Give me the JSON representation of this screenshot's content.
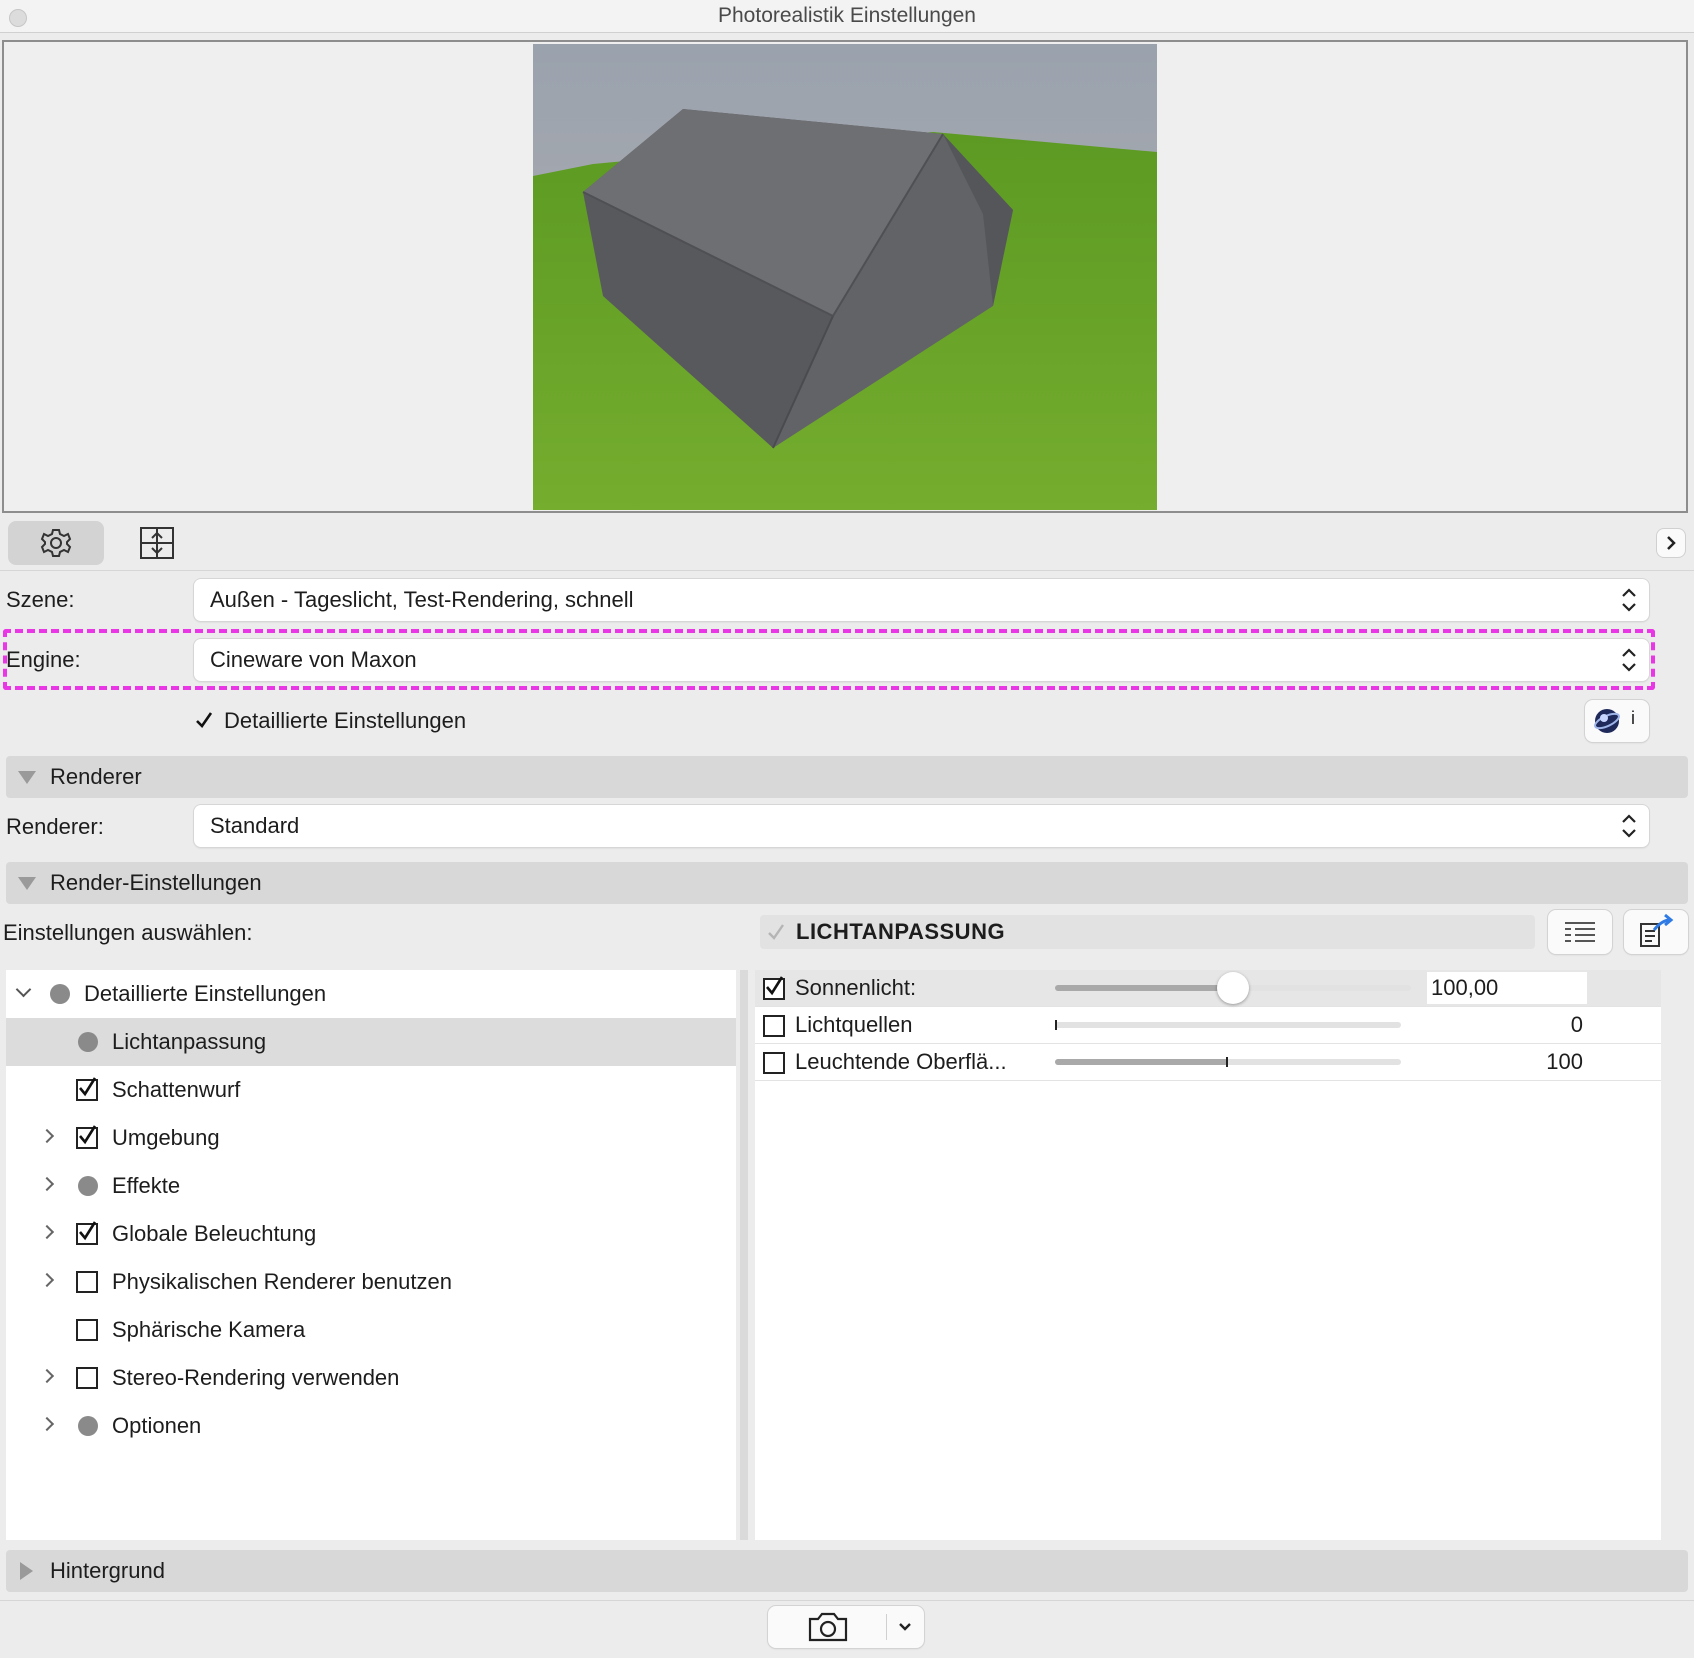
{
  "window": {
    "title": "Photorealistik Einstellungen"
  },
  "preview": {
    "icon": "rendered-house-preview"
  },
  "toolbar": {
    "settings_icon": "gear-icon",
    "frame_icon": "frame-crop-icon",
    "expand_icon": "chevron-right-icon"
  },
  "scene": {
    "label": "Szene:",
    "value": "Außen - Tageslicht, Test-Rendering, schnell"
  },
  "engine": {
    "label": "Engine:",
    "value": "Cineware von Maxon"
  },
  "detailed": {
    "label": "Detaillierte Einstellungen",
    "checked": true,
    "info_icon_text": "i"
  },
  "renderer_section": {
    "title": "Renderer",
    "label": "Renderer:",
    "value": "Standard"
  },
  "render_settings_section": {
    "title": "Render-Einstellungen",
    "select_label": "Einstellungen auswählen:"
  },
  "panel_header": {
    "title": "LICHTANPASSUNG",
    "list_icon": "list-view-icon",
    "export_icon": "export-icon"
  },
  "tree": [
    {
      "label": "Detaillierte Einstellungen",
      "marker": "dot",
      "expanded": true
    },
    {
      "label": "Lichtanpassung",
      "marker": "dot",
      "selected": true
    },
    {
      "label": "Schattenwurf",
      "marker": "checked"
    },
    {
      "label": "Umgebung",
      "marker": "checked",
      "expandable": true
    },
    {
      "label": "Effekte",
      "marker": "dot",
      "expandable": true
    },
    {
      "label": "Globale Beleuchtung",
      "marker": "checked",
      "expandable": true
    },
    {
      "label": "Physikalischen Renderer benutzen",
      "marker": "unchecked",
      "expandable": true
    },
    {
      "label": "Sphärische Kamera",
      "marker": "unchecked"
    },
    {
      "label": "Stereo-Rendering verwenden",
      "marker": "unchecked",
      "expandable": true
    },
    {
      "label": "Optionen",
      "marker": "dot",
      "expandable": true
    }
  ],
  "params": [
    {
      "label": "Sonnenlicht:",
      "checked": true,
      "level": 0.5,
      "value": "100,00"
    },
    {
      "label": "Lichtquellen",
      "checked": false,
      "level": 0.0,
      "value": "0"
    },
    {
      "label": "Leuchtende Oberflä...",
      "checked": false,
      "level": 0.5,
      "value": "100"
    }
  ],
  "background_section": {
    "title": "Hintergrund"
  },
  "bottom": {
    "camera_icon": "camera-icon",
    "dropdown_icon": "chevron-down-icon"
  },
  "colors": {
    "highlight": "#ea37e6",
    "grass": "#6da52a",
    "roof": "#6b6b6f"
  }
}
